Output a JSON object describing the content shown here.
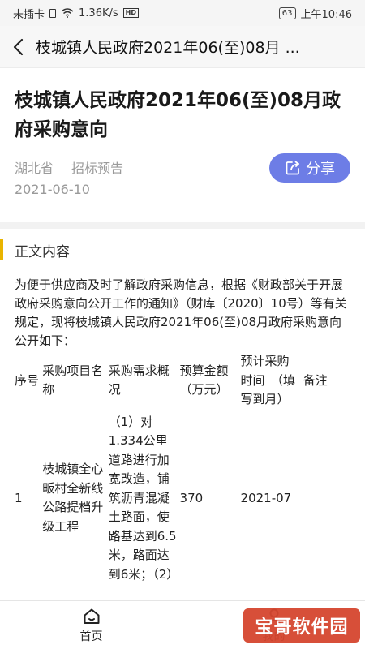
{
  "status_bar": {
    "carrier": "未插卡",
    "speed": "1.36K/s",
    "battery": "63",
    "time": "上午10:46"
  },
  "nav": {
    "title": "枝城镇人民政府2021年06(至)08月 ..."
  },
  "article": {
    "title": "枝城镇人民政府2021年06(至)08月政府采购意向",
    "province": "湖北省",
    "category": "招标预告",
    "date": "2021-06-10",
    "share_label": "分享"
  },
  "section": {
    "title": "正文内容"
  },
  "body_text": "为便于供应商及时了解政府采购信息，根据《财政部关于开展政府采购意向公开工作的通知》（财库〔2020〕10号）等有关规定，现将枝城镇人民政府2021年06(至)08月政府采购意向公开如下：",
  "table": {
    "headers": [
      "序号",
      "采购项目名称",
      "采购需求概况",
      "预算金额（万元）",
      "预计采购时间　（填写到月）",
      "备注"
    ],
    "rows": [
      {
        "no": "1",
        "name": "枝城镇全心畈村全新线公路提档升级工程",
        "desc": "（1）对1.334公里道路进行加宽改造，铺筑沥青混凝土路面，使路基达到6.5米，路面达到6米；（2）",
        "budget": "370",
        "time": "2021-07",
        "note": ""
      }
    ]
  },
  "tabs": [
    {
      "label": "首页"
    },
    {
      "label": "我的"
    }
  ],
  "watermark": "宝哥软件园",
  "colors": {
    "share_button": "#6d7de6",
    "section_accent": "#e9b400",
    "watermark": "#d5462f"
  }
}
